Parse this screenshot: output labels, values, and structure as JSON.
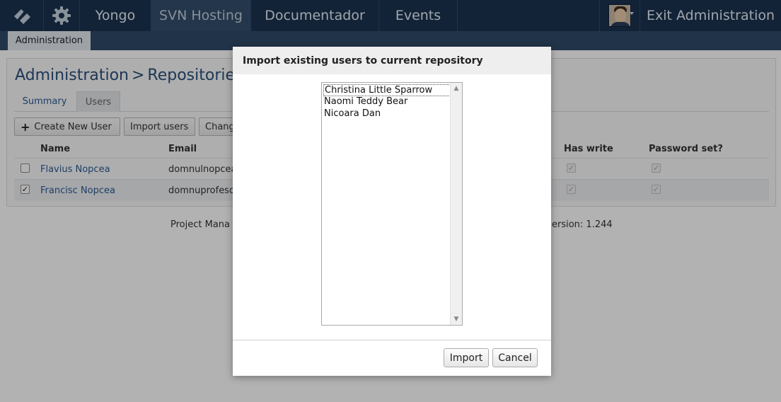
{
  "topbar": {
    "items": [
      "Yongo",
      "SVN Hosting",
      "Documentador",
      "Events"
    ],
    "exit_label": "Exit Administration"
  },
  "subnav": {
    "active_tab": "Administration"
  },
  "breadcrumb": {
    "part1": "Administration",
    "part2": "Repositories",
    "separator": ">"
  },
  "tabs": {
    "summary": "Summary",
    "users": "Users"
  },
  "toolbar": {
    "create_user": "Create New User",
    "import_users": "Import users",
    "change": "Chang"
  },
  "table": {
    "headers": {
      "name": "Name",
      "email": "Email",
      "has_write": "Has write",
      "password_set": "Password set?"
    },
    "rows": [
      {
        "selected": false,
        "name": "Flavius Nopcea",
        "email": "domnulnopcea",
        "has_write": true,
        "password_set": true
      },
      {
        "selected": true,
        "name": "Francisc Nopcea",
        "email": "domnuprofeso",
        "has_write": true,
        "password_set": true
      }
    ]
  },
  "footer": {
    "left": "Project Mana",
    "version": "ersion: 1.244"
  },
  "modal": {
    "title": "Import existing users to current repository",
    "users": [
      "Christina Little Sparrow",
      "Naomi Teddy Bear",
      "Nicoara Dan"
    ],
    "import_label": "Import",
    "cancel_label": "Cancel"
  },
  "colors": {
    "topbar": "#1b3350",
    "subbar": "#304a68",
    "link": "#2a5a94"
  }
}
